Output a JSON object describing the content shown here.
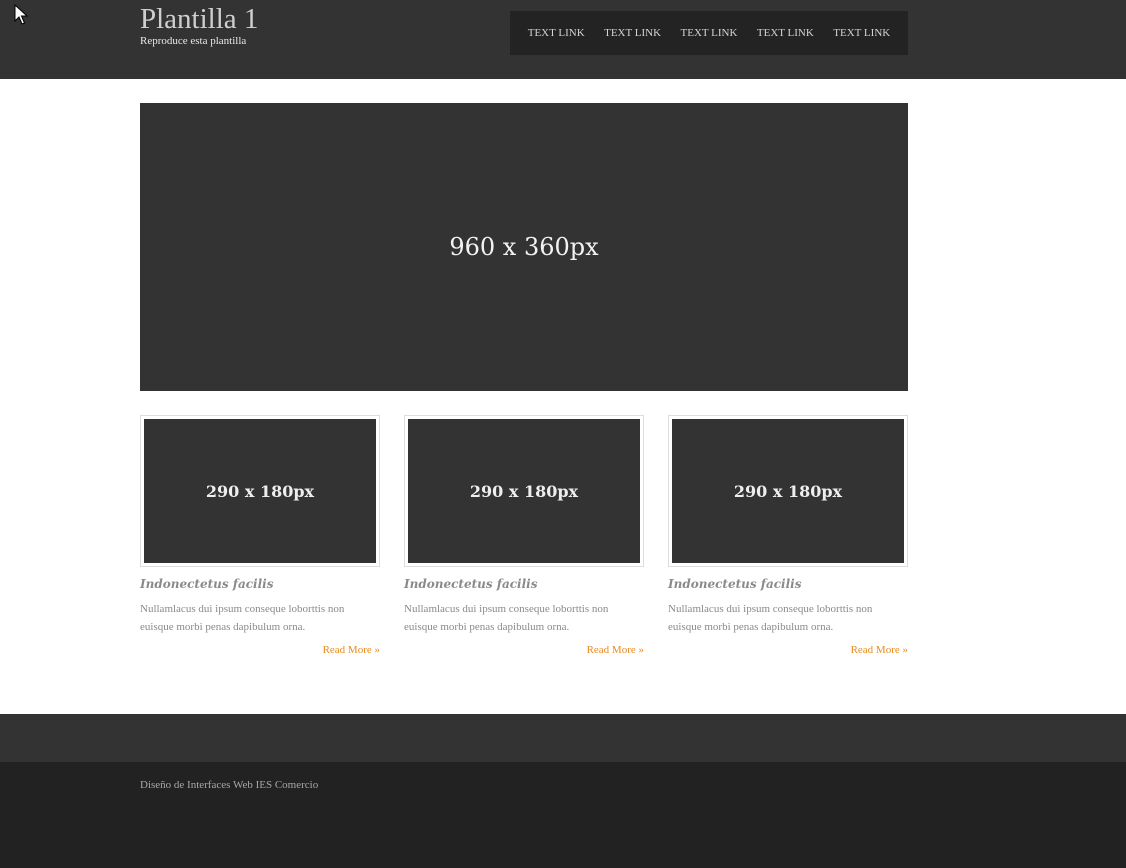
{
  "header": {
    "title": "Plantilla 1",
    "subtitle": "Reproduce esta plantilla",
    "nav": [
      "TEXT LINK",
      "TEXT LINK",
      "TEXT LINK",
      "TEXT LINK",
      "TEXT LINK"
    ]
  },
  "hero": {
    "placeholder": "960 x 360px"
  },
  "cards": [
    {
      "image": "290 x 180px",
      "title": "Indonectetus facilis",
      "text": "Nullamlacus dui ipsum conseque loborttis non euisque morbi penas dapibulum orna.",
      "link": "Read More »"
    },
    {
      "image": "290 x 180px",
      "title": "Indonectetus facilis",
      "text": "Nullamlacus dui ipsum conseque loborttis non euisque morbi penas dapibulum orna.",
      "link": "Read More »"
    },
    {
      "image": "290 x 180px",
      "title": "Indonectetus facilis",
      "text": "Nullamlacus dui ipsum conseque loborttis non euisque morbi penas dapibulum orna.",
      "link": "Read More »"
    }
  ],
  "footer": {
    "text": "Diseño de Interfaces Web IES Comercio"
  },
  "colors": {
    "dark": "#333333",
    "darker": "#222222",
    "accent": "#e8891f"
  },
  "icons": {
    "cursor": "mouse-pointer-icon"
  }
}
